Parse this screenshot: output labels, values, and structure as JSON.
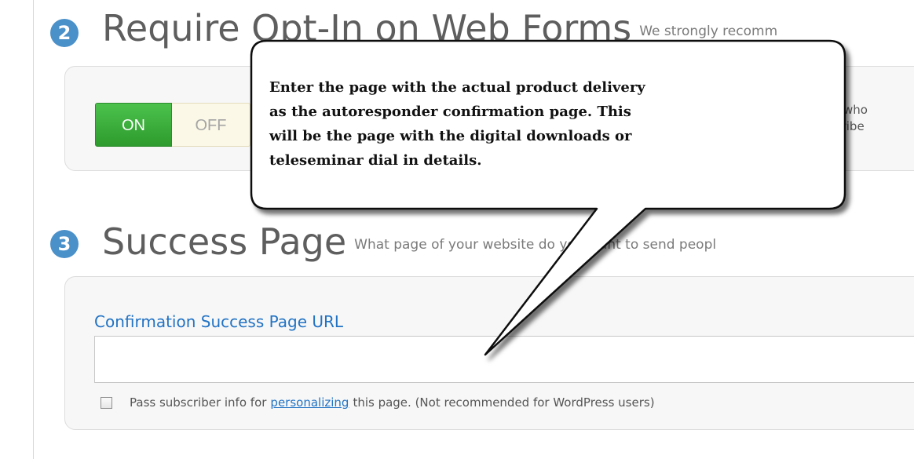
{
  "opt_in": {
    "step_number": "2",
    "title": "Require Opt-In on Web Forms",
    "subtitle": "We strongly recomm",
    "toggle_on_label": "ON",
    "toggle_off_label": "OFF",
    "description_line1": "nts who",
    "description_line2": "bscribe"
  },
  "success_page": {
    "step_number": "3",
    "title": "Success Page",
    "subtitle": "What page of your website do you want to send peopl",
    "field_label": "Confirmation Success Page URL",
    "url_value": "",
    "pass_text_before": "Pass subscriber info for",
    "pass_link": "personalizing",
    "pass_text_after": "this page. (Not recommended for WordPress users)"
  },
  "callout": {
    "text": "Enter the page with the actual product delivery\nas the autoresponder confirmation page.  This\nwill be the page with the digital downloads or\nteleseminar dial in details."
  },
  "colors": {
    "badge": "#4a90c9",
    "toggle_on": "#3cb33c",
    "link": "#2273c4"
  }
}
